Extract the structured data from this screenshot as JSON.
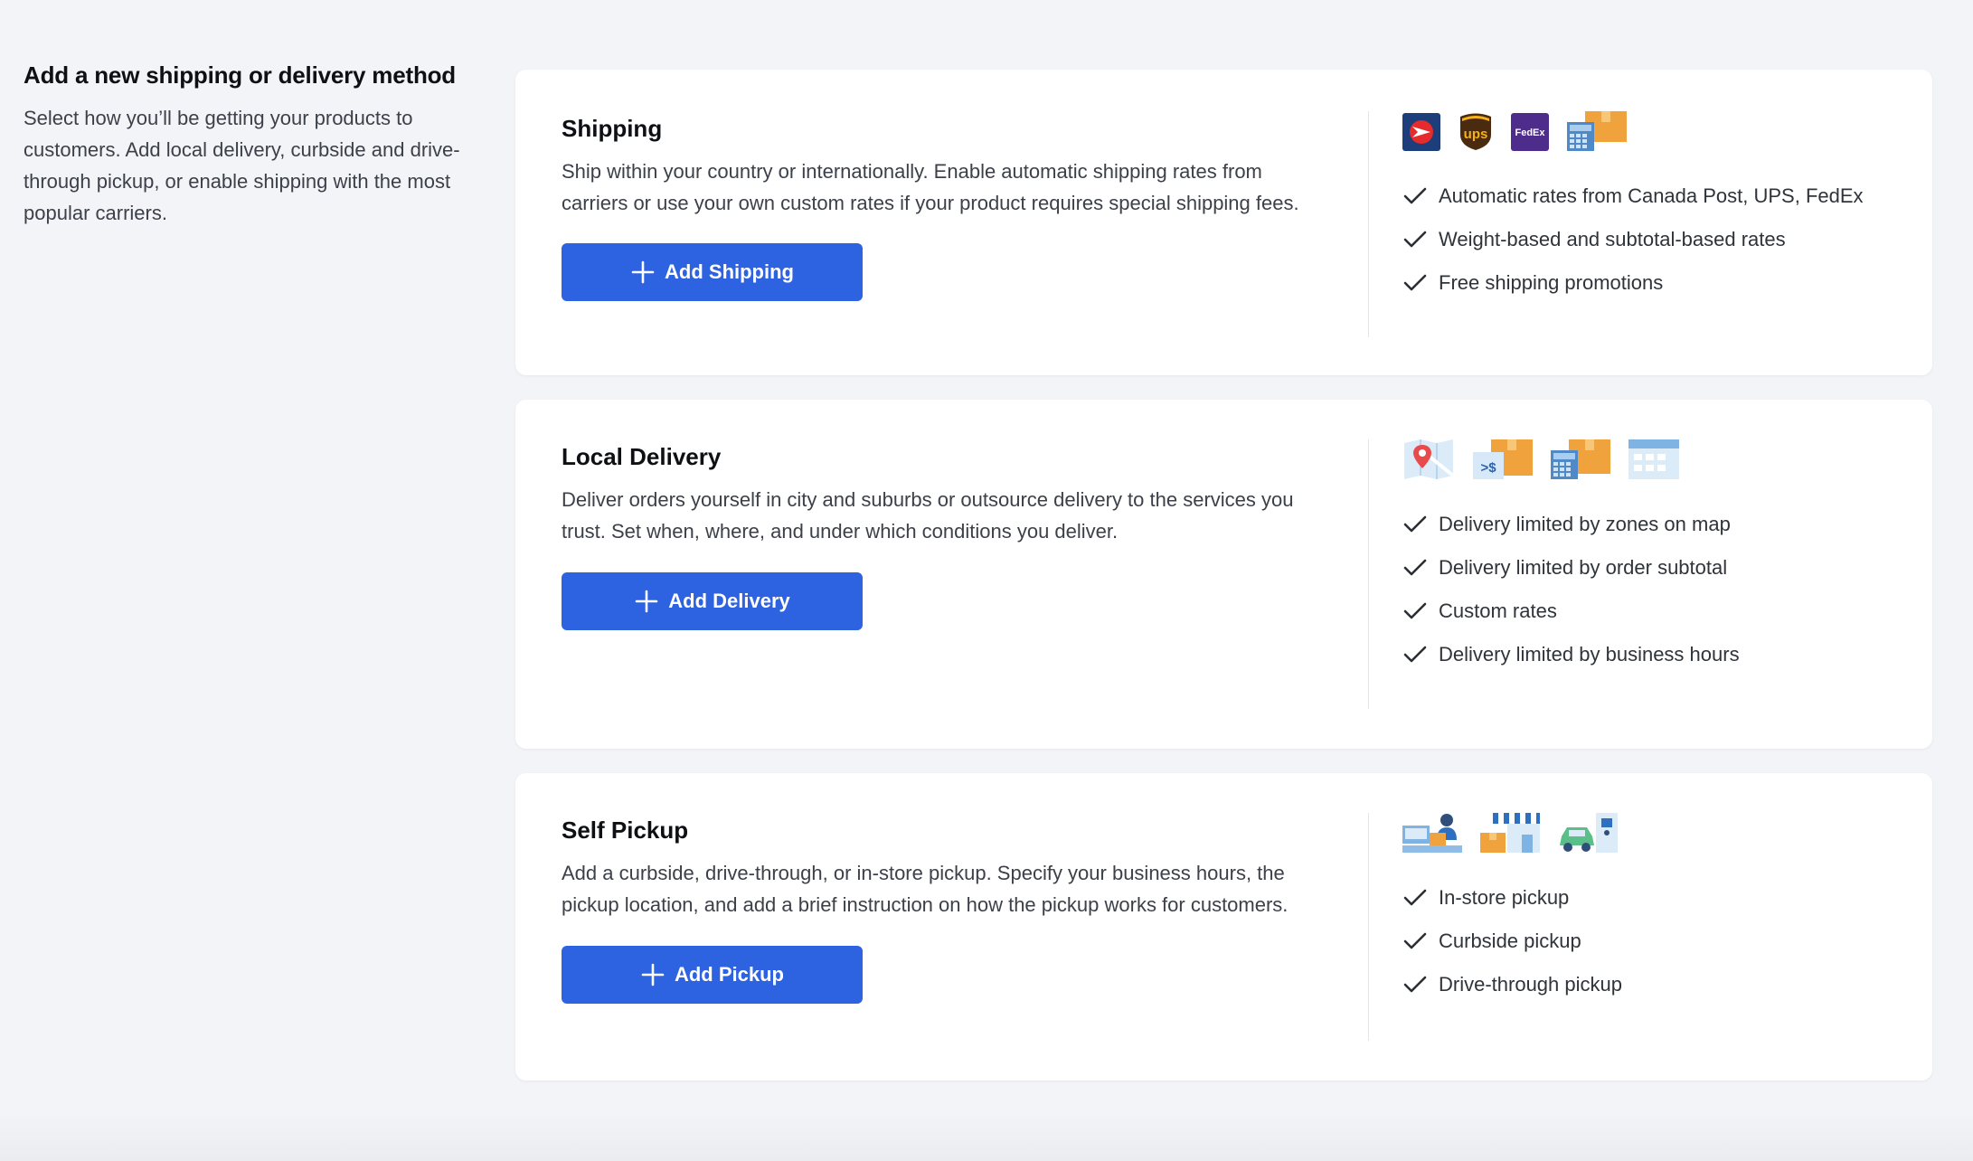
{
  "intro": {
    "title": "Add a new shipping or delivery method",
    "description": "Select how you’ll be getting your products to customers. Add local delivery, curbside and drive-through pickup, or enable shipping with the most popular carriers."
  },
  "cards": {
    "shipping": {
      "title": "Shipping",
      "description": "Ship within your country or internationally. Enable automatic shipping rates from carriers or use your own custom rates if your product requires special shipping fees.",
      "button_label": "Add Shipping",
      "icons": [
        "canada-post-icon",
        "ups-icon",
        "fedex-icon",
        "calculator-boxes-icon"
      ],
      "logo_text": {
        "ups": "ups",
        "fedex": "FedEx"
      },
      "features": [
        "Automatic rates from Canada Post, UPS, FedEx",
        "Weight-based and subtotal-based rates",
        "Free shipping promotions"
      ]
    },
    "local_delivery": {
      "title": "Local Delivery",
      "description": "Deliver orders yourself in city and suburbs or outsource delivery to the services you trust. Set when, where, and under which conditions you deliver.",
      "button_label": "Add Delivery",
      "icons": [
        "map-pin-icon",
        "subtotal-boxes-icon",
        "calculator-boxes-icon",
        "calendar-icon"
      ],
      "icon_text": {
        "subtotal": ">$"
      },
      "features": [
        "Delivery limited by zones on map",
        "Delivery limited by order subtotal",
        "Custom rates",
        "Delivery limited by business hours"
      ]
    },
    "self_pickup": {
      "title": "Self Pickup",
      "description": "Add a curbside, drive-through, or in-store pickup. Specify your business hours, the pickup location, and add a brief instruction on how the pickup works for customers.",
      "button_label": "Add Pickup",
      "icons": [
        "store-counter-icon",
        "storefront-icon",
        "drive-through-icon"
      ],
      "features": [
        "In-store pickup",
        "Curbside pickup",
        "Drive-through pickup"
      ]
    }
  },
  "colors": {
    "background": "#f3f4f8",
    "card": "#ffffff",
    "primary_button": "#2d62e0",
    "text_dark": "#0e1014",
    "text_body": "#3c4049",
    "divider": "#e3e5ea",
    "icon_orange": "#f0a23c",
    "icon_blue": "#5b9bd9"
  }
}
